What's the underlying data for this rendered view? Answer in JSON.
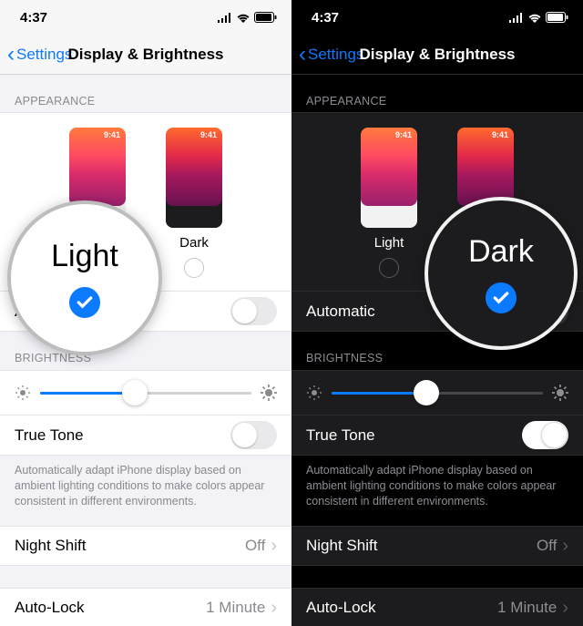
{
  "status": {
    "time": "4:37",
    "navIcon": "◅"
  },
  "nav": {
    "back": "Settings",
    "title": "Display & Brightness"
  },
  "sections": {
    "appearance": "APPEARANCE",
    "brightness": "BRIGHTNESS"
  },
  "appearance": {
    "lightLabel": "Light",
    "darkLabel": "Dark",
    "previewTime": "9:41"
  },
  "rows": {
    "automatic": "Automatic",
    "trueTone": "True Tone",
    "nightShift": "Night Shift",
    "nightShiftValue": "Off",
    "autoLock": "Auto-Lock",
    "autoLockValue": "1 Minute"
  },
  "trueToneFooter": "Automatically adapt iPhone display based on ambient lighting conditions to make colors appear consistent in different environments.",
  "magnifier": {
    "light": "Light",
    "dark": "Dark"
  }
}
